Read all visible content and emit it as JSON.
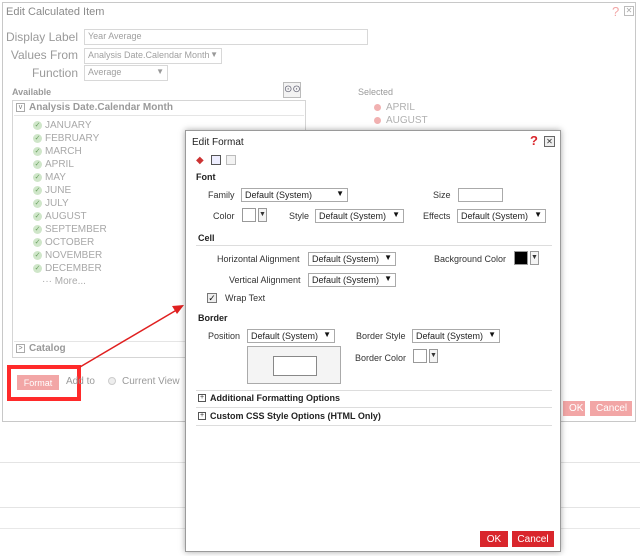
{
  "background_dialog": {
    "title": "Edit Calculated Item",
    "display_label": {
      "label": "Display Label",
      "value": "Year Average"
    },
    "values_from": {
      "label": "Values From",
      "value": "Analysis Date.Calendar Month"
    },
    "function": {
      "label": "Function",
      "value": "Average"
    },
    "available_label": "Available",
    "selected_label": "Selected",
    "tree_header": "Analysis Date.Calendar Month",
    "months": [
      "JANUARY",
      "FEBRUARY",
      "MARCH",
      "APRIL",
      "MAY",
      "JUNE",
      "JULY",
      "AUGUST",
      "SEPTEMBER",
      "OCTOBER",
      "NOVEMBER",
      "DECEMBER"
    ],
    "more_label": "More...",
    "selected_items": [
      "APRIL",
      "AUGUST"
    ],
    "catalog_label": "Catalog",
    "format_button": "Format",
    "add_to_label": "Add to",
    "current_view_label": "Current View",
    "ok_label": "OK",
    "cancel_label": "Cancel",
    "help_icon": "?",
    "close_icon": "✕"
  },
  "edit_format": {
    "title": "Edit Format",
    "help_icon": "?",
    "close_icon": "✕",
    "font": {
      "section": "Font",
      "family_label": "Family",
      "family_value": "Default (System)",
      "size_label": "Size",
      "size_value": "",
      "color_label": "Color",
      "style_label": "Style",
      "style_value": "Default (System)",
      "effects_label": "Effects",
      "effects_value": "Default (System)"
    },
    "cell": {
      "section": "Cell",
      "h_align_label": "Horizontal Alignment",
      "h_align_value": "Default (System)",
      "bg_color_label": "Background Color",
      "v_align_label": "Vertical Alignment",
      "v_align_value": "Default (System)",
      "wrap_text_label": "Wrap Text"
    },
    "border": {
      "section": "Border",
      "position_label": "Position",
      "position_value": "Default (System)",
      "style_label": "Border Style",
      "style_value": "Default (System)",
      "color_label": "Border Color"
    },
    "additional_label": "Additional Formatting Options",
    "css_label": "Custom CSS Style Options (HTML Only)",
    "ok_label": "OK",
    "cancel_label": "Cancel"
  },
  "colors": {
    "accent_red": "#d9262c",
    "highlight_box": "#ff2a2a",
    "bg_color_swatch": "#000000"
  }
}
